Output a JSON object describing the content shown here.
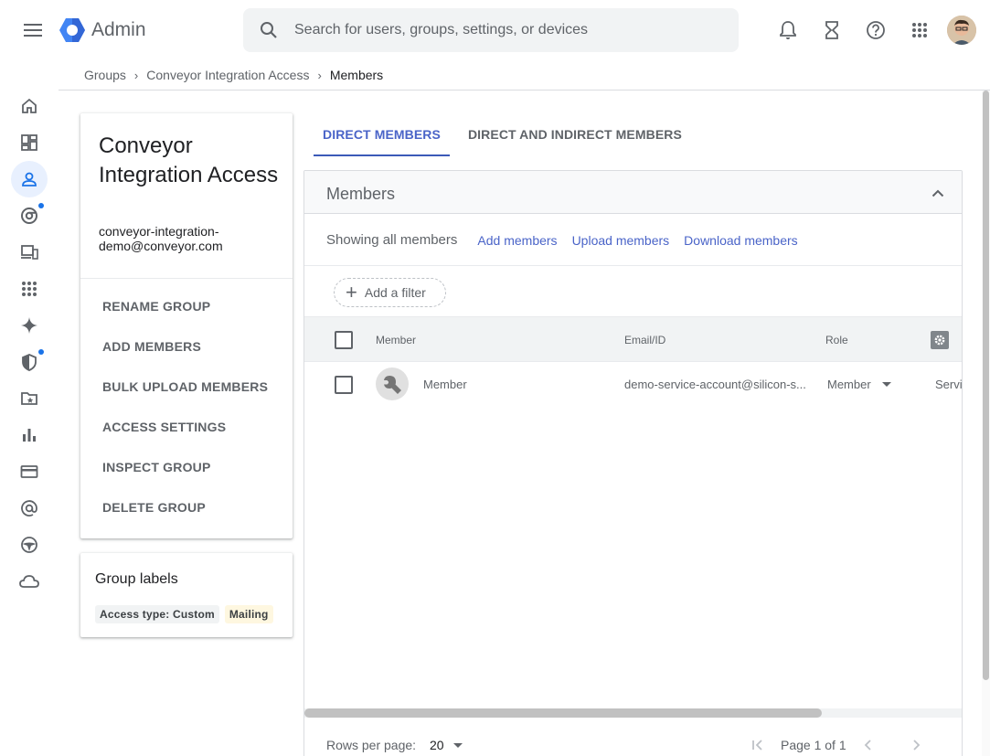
{
  "header": {
    "app_name": "Admin",
    "search_placeholder": "Search for users, groups, settings, or devices",
    "brand_color": "#4285f4"
  },
  "breadcrumb": {
    "items": [
      "Groups",
      "Conveyor Integration Access"
    ],
    "current": "Members"
  },
  "rail": {
    "items": [
      "home-icon",
      "dashboard-icon",
      "users-icon",
      "chrome-icon",
      "devices-icon",
      "apps-icon",
      "gemini-icon",
      "security-icon",
      "drive-icon",
      "reports-icon",
      "billing-icon",
      "account-icon",
      "rules-icon",
      "storage-icon"
    ]
  },
  "group": {
    "name": "Conveyor Integration Access",
    "email": "conveyor-integration-demo@conveyor.com",
    "actions": [
      "RENAME GROUP",
      "ADD MEMBERS",
      "BULK UPLOAD MEMBERS",
      "ACCESS SETTINGS",
      "INSPECT GROUP",
      "DELETE GROUP"
    ]
  },
  "labels": {
    "title": "Group labels",
    "chips": [
      "Access type: Custom",
      "Mailing"
    ]
  },
  "tabs": [
    "DIRECT MEMBERS",
    "DIRECT AND INDIRECT MEMBERS"
  ],
  "members_panel": {
    "title": "Members",
    "showing": "Showing all members",
    "actions": [
      "Add members",
      "Upload members",
      "Download members"
    ],
    "filter_label": "Add a filter",
    "columns": [
      "Member",
      "Email/ID",
      "Role"
    ],
    "rows": [
      {
        "member": "Member",
        "email": "demo-service-account@silicon-s...",
        "role": "Member",
        "type": "Servi"
      }
    ],
    "rows_per_page_label": "Rows per page:",
    "rows_per_page": "20",
    "page_text": "Page 1 of 1"
  },
  "colors": {
    "link": "#4a64c8",
    "active_rail": "#e8f0fe",
    "notification_dot": "#1a73e8"
  }
}
